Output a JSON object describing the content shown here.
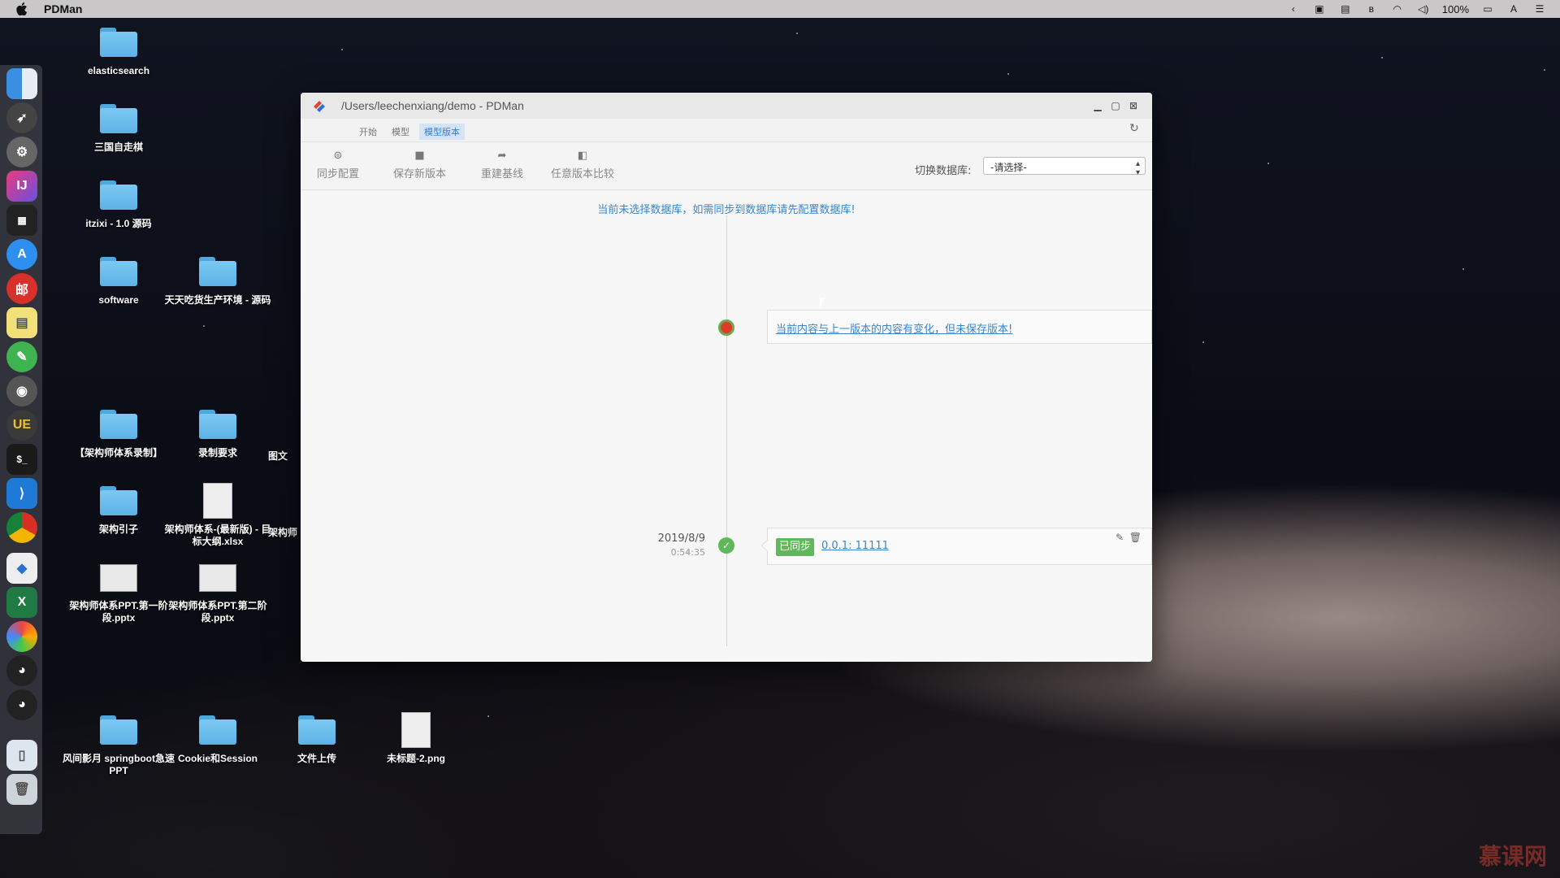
{
  "menubar": {
    "app_name": "PDMan",
    "battery": "100%"
  },
  "desktop_icons": [
    {
      "label": "elasticsearch"
    },
    {
      "label": "三国自走棋"
    },
    {
      "label": "itzixi - 1.0 源码"
    },
    {
      "label": "software"
    },
    {
      "label": "天天吃货生产环境 - 源码"
    },
    {
      "label": "【架构师体系录制】"
    },
    {
      "label": "录制要求"
    },
    {
      "label": "图文"
    },
    {
      "label": "架构引子"
    },
    {
      "label": "架构师体系-(最新版) - 目标大纲.xlsx"
    },
    {
      "label": "架构师"
    },
    {
      "label": "架构师体系PPT.第一阶段.pptx"
    },
    {
      "label": "架构师体系PPT.第二阶段.pptx"
    },
    {
      "label": "风间影月 springboot急速PPT"
    },
    {
      "label": "Cookie和Session"
    },
    {
      "label": "文件上传"
    },
    {
      "label": "未标题-2.png"
    }
  ],
  "window": {
    "title": "/Users/leechenxiang/demo - PDMan",
    "tabs": [
      {
        "label": "开始"
      },
      {
        "label": "模型"
      },
      {
        "label": "模型版本"
      }
    ],
    "toolbar": {
      "sync_config": "同步配置",
      "save_version": "保存新版本",
      "rebuild_baseline": "重建基线",
      "compare_versions": "任意版本比较",
      "db_label": "切换数据库:",
      "db_select_value": "-请选择-"
    },
    "notice": "当前未选择数据库，如需同步到数据库请先配置数据库!",
    "timeline": {
      "unsaved_text": "当前内容与上一版本的内容有变化，但未保存版本!",
      "version": {
        "date": "2019/8/9",
        "time": "0:54:35",
        "badge": "已同步",
        "label": "0.0.1: 11111"
      }
    }
  },
  "watermark": "慕课网",
  "colors": {
    "accent_blue": "#3a86cc",
    "sync_green": "#5fb85a",
    "unsaved_red": "#e03a2a"
  }
}
